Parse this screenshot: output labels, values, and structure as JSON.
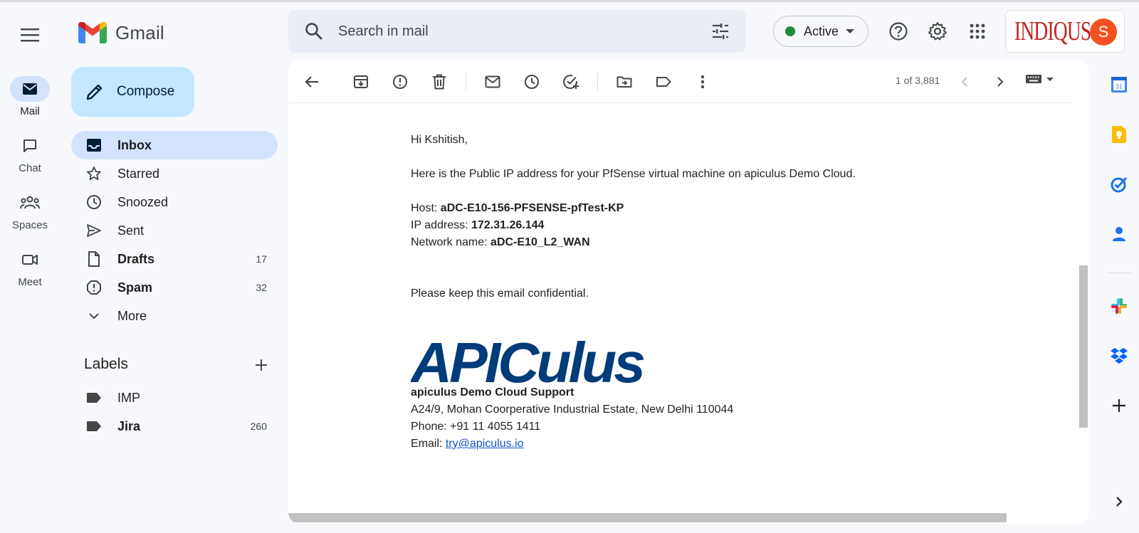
{
  "app": {
    "name": "Gmail"
  },
  "rail": [
    {
      "label": "Mail",
      "icon": "mail-icon"
    },
    {
      "label": "Chat",
      "icon": "chat-icon"
    },
    {
      "label": "Spaces",
      "icon": "spaces-icon"
    },
    {
      "label": "Meet",
      "icon": "meet-icon"
    }
  ],
  "search": {
    "placeholder": "Search in mail"
  },
  "status": {
    "label": "Active",
    "color": "#1e8e3e"
  },
  "account": {
    "brand": "INDIQUS",
    "avatar_letter": "S",
    "avatar_color": "#f4511e"
  },
  "compose": {
    "label": "Compose"
  },
  "nav": [
    {
      "label": "Inbox",
      "count": "",
      "bold": true,
      "active": true,
      "icon": "inbox-icon"
    },
    {
      "label": "Starred",
      "count": "",
      "bold": false,
      "icon": "star-icon"
    },
    {
      "label": "Snoozed",
      "count": "",
      "bold": false,
      "icon": "clock-icon"
    },
    {
      "label": "Sent",
      "count": "",
      "bold": false,
      "icon": "send-icon"
    },
    {
      "label": "Drafts",
      "count": "17",
      "bold": true,
      "icon": "draft-icon"
    },
    {
      "label": "Spam",
      "count": "32",
      "bold": true,
      "icon": "spam-icon"
    },
    {
      "label": "More",
      "count": "",
      "bold": false,
      "icon": "chevron-down-icon"
    }
  ],
  "labels": {
    "title": "Labels",
    "items": [
      {
        "label": "IMP",
        "count": "",
        "bold": false
      },
      {
        "label": "Jira",
        "count": "260",
        "bold": true
      }
    ]
  },
  "toolbar": {
    "pager": "1 of 3,881"
  },
  "email": {
    "greeting": "Hi Kshitish,",
    "intro": "Here is the Public IP address for your PfSense virtual machine on apiculus Demo Cloud.",
    "host_label": "Host: ",
    "host_value": "aDC-E10-156-PFSENSE-pfTest-KP",
    "ip_label": "IP address: ",
    "ip_value": "172.31.26.144",
    "network_label": "Network name: ",
    "network_value": "aDC-E10_L2_WAN",
    "confidential": "Please keep this email confidential.",
    "logo_text": "APICulus",
    "signature_name": "apiculus Demo Cloud Support",
    "address": "A24/9, Mohan Coorperative Industrial Estate, New Delhi 110044",
    "phone": "Phone: +91 11 4055 1411",
    "email_label": "Email: ",
    "email_link": "try@apiculus.io",
    "brand_color": "#003b7a"
  }
}
